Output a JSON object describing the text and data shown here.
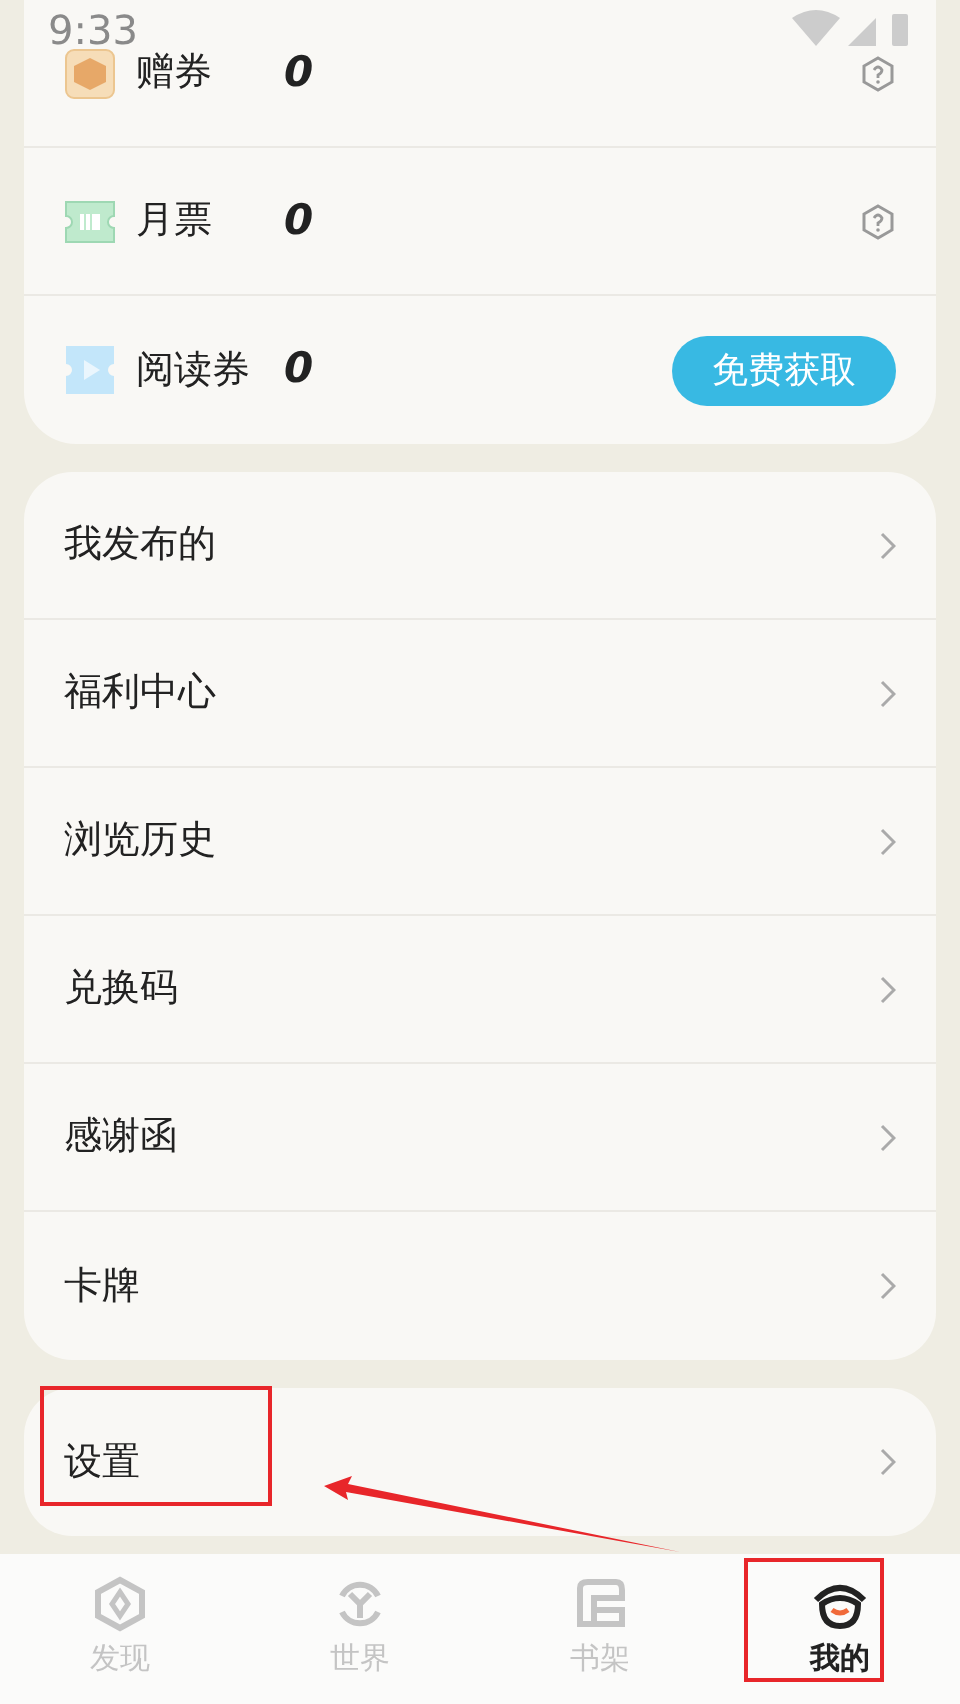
{
  "status_bar": {
    "time": "9:33"
  },
  "tickets": [
    {
      "kind": "gift",
      "label": "赠券",
      "count": "0",
      "help": true
    },
    {
      "kind": "monthly",
      "label": "月票",
      "count": "0",
      "help": true
    },
    {
      "kind": "reading",
      "label": "阅读券",
      "count": "0",
      "button": "免费获取"
    }
  ],
  "menu": [
    {
      "label": "我发布的"
    },
    {
      "label": "福利中心"
    },
    {
      "label": "浏览历史"
    },
    {
      "label": "兑换码"
    },
    {
      "label": "感谢函"
    },
    {
      "label": "卡牌"
    }
  ],
  "settings": {
    "label": "设置"
  },
  "tabs": [
    {
      "kind": "discover",
      "label": "发现",
      "selected": false
    },
    {
      "kind": "world",
      "label": "世界",
      "selected": false
    },
    {
      "kind": "shelf",
      "label": "书架",
      "selected": false
    },
    {
      "kind": "me",
      "label": "我的",
      "selected": true
    }
  ]
}
